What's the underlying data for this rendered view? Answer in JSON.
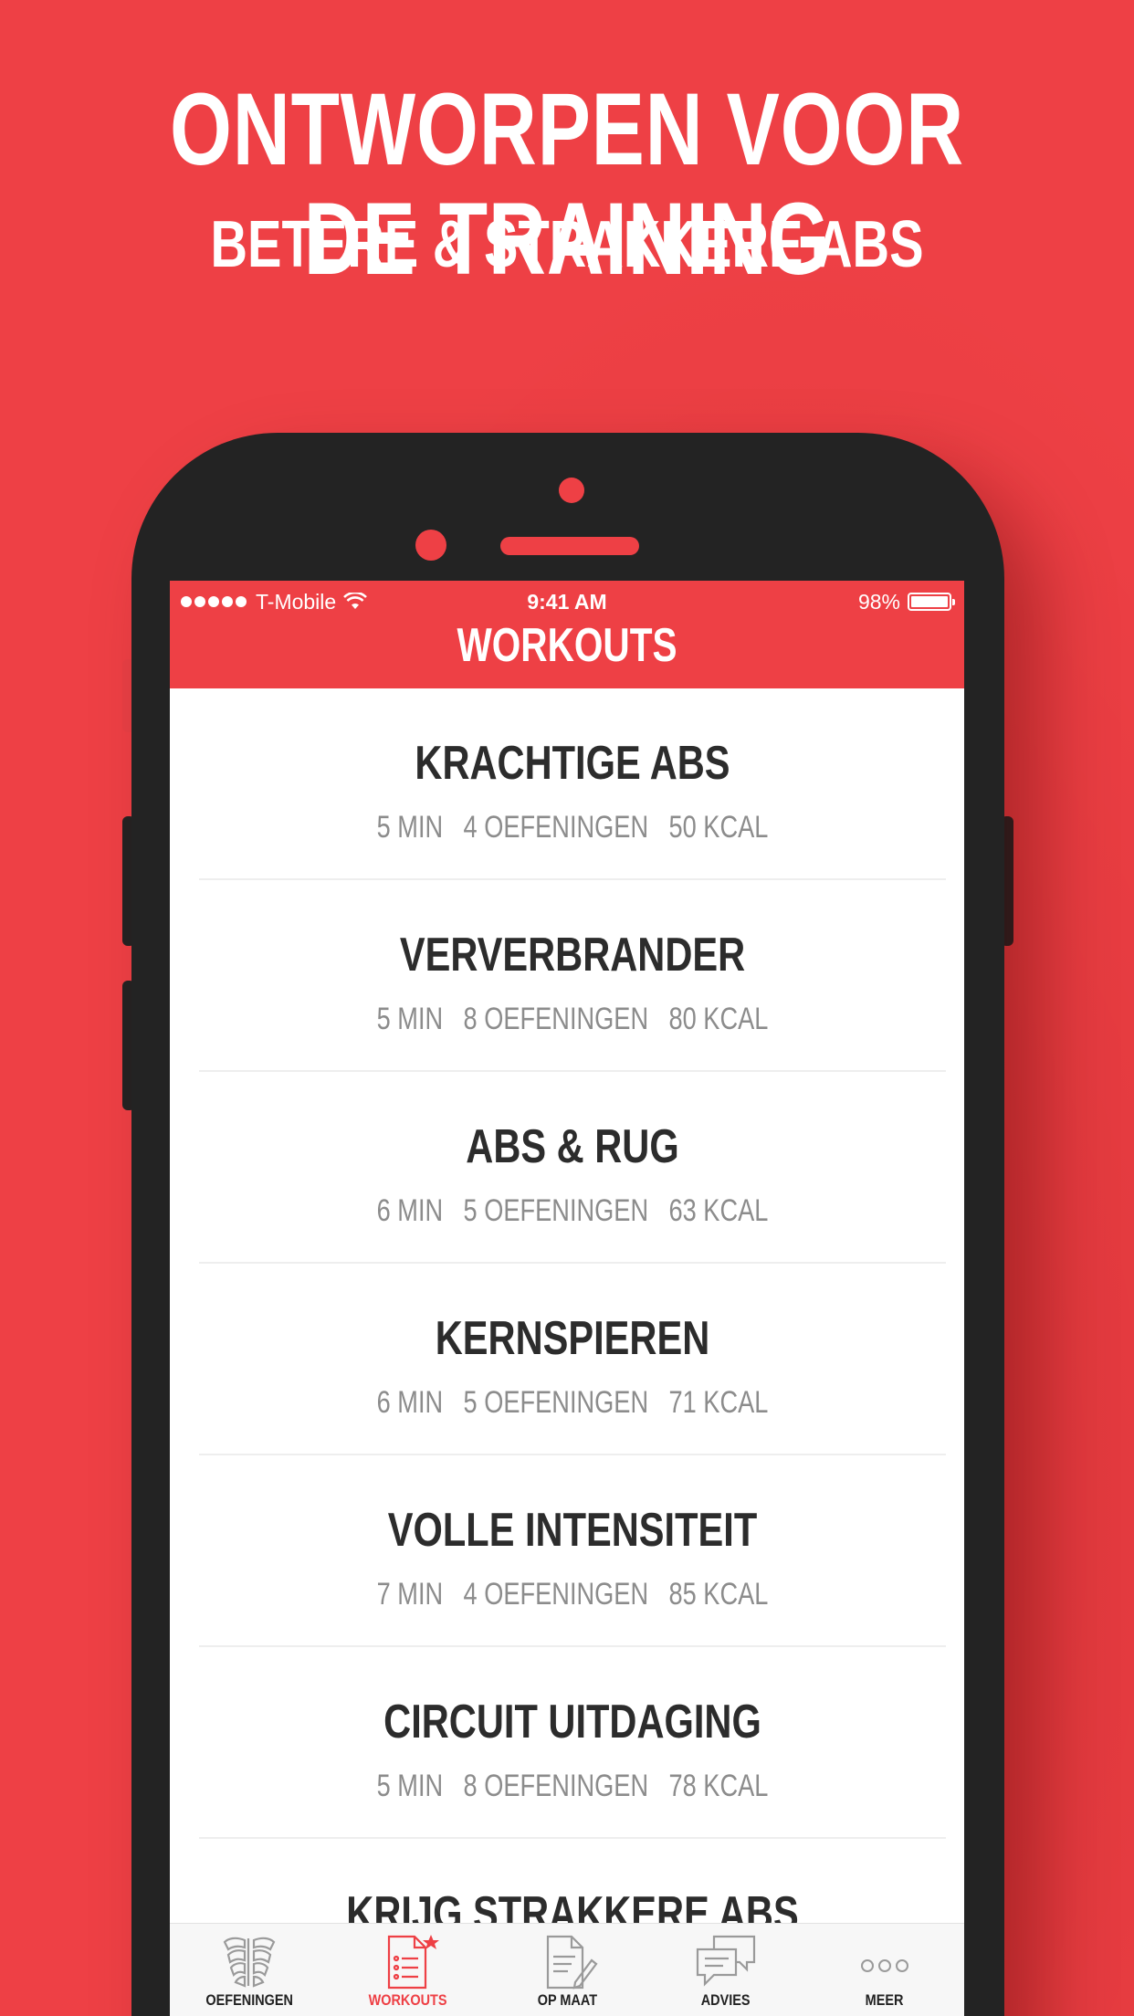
{
  "promo": {
    "headline": "ONTWORPEN VOOR DE TRAINING",
    "subheadline": "BETERE & STRAKKERE ABS"
  },
  "status_bar": {
    "carrier": "T-Mobile",
    "time": "9:41 AM",
    "battery": "98%"
  },
  "nav": {
    "title": "WORKOUTS"
  },
  "workouts": [
    {
      "title": "KRACHTIGE ABS",
      "duration": "5 MIN",
      "exercises": "4 OEFENINGEN",
      "calories": "50 KCAL"
    },
    {
      "title": "VERVERBRANDER",
      "duration": "5 MIN",
      "exercises": "8 OEFENINGEN",
      "calories": "80 KCAL"
    },
    {
      "title": "ABS & RUG",
      "duration": "6 MIN",
      "exercises": "5 OEFENINGEN",
      "calories": "63 KCAL"
    },
    {
      "title": "KERNSPIEREN",
      "duration": "6 MIN",
      "exercises": "5 OEFENINGEN",
      "calories": "71 KCAL"
    },
    {
      "title": "VOLLE INTENSITEIT",
      "duration": "7 MIN",
      "exercises": "4 OEFENINGEN",
      "calories": "85 KCAL"
    },
    {
      "title": "CIRCUIT UITDAGING",
      "duration": "5 MIN",
      "exercises": "8 OEFENINGEN",
      "calories": "78 KCAL"
    },
    {
      "title": "KRIJG STRAKKERE ABS",
      "duration": "",
      "exercises": "",
      "calories": ""
    }
  ],
  "tabs": [
    {
      "label": "OEFENINGEN",
      "icon": "abs-icon"
    },
    {
      "label": "WORKOUTS",
      "icon": "checklist-icon",
      "active": true
    },
    {
      "label": "OP MAAT",
      "icon": "edit-document-icon"
    },
    {
      "label": "ADVIES",
      "icon": "chat-bubbles-icon"
    },
    {
      "label": "MEER",
      "icon": "more-icon"
    }
  ],
  "colors": {
    "accent": "#ee4045",
    "title_text": "#2c2c2c",
    "meta_text": "#8c8c8c",
    "phone_body": "#232323"
  }
}
